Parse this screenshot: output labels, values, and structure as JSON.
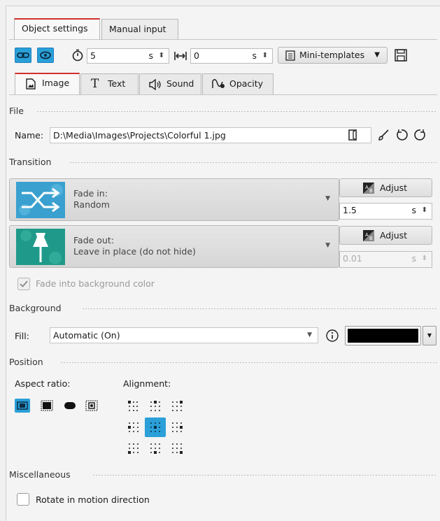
{
  "object_tabs": {
    "object_settings": "Object settings",
    "manual_input": "Manual input"
  },
  "toolbar": {
    "duration_value": "5",
    "duration_unit": "s",
    "offset_value": "0",
    "offset_unit": "s",
    "mini_templates": "Mini-templates"
  },
  "content_tabs": {
    "image": "Image",
    "text": "Text",
    "sound": "Sound",
    "opacity": "Opacity"
  },
  "file": {
    "section": "File",
    "name_label": "Name:",
    "name_value": "D:\\Media\\Images\\Projects\\Colorful 1.jpg"
  },
  "transition": {
    "section": "Transition",
    "fade_in_label": "Fade in:",
    "fade_in_value": "Random",
    "fade_out_label": "Fade out:",
    "fade_out_value": "Leave in place (do not hide)",
    "adjust_label": "Adjust",
    "fade_in_duration": "1.5",
    "fade_out_duration": "0.01",
    "unit": "s",
    "fade_bg_label": "Fade into background color",
    "fade_bg_checked": true
  },
  "background": {
    "section": "Background",
    "fill_label": "Fill:",
    "fill_value": "Automatic (On)",
    "color": "#000000"
  },
  "position": {
    "section": "Position",
    "aspect_label": "Aspect ratio:",
    "alignment_label": "Alignment:",
    "selected_alignment": "center"
  },
  "misc": {
    "section": "Miscellaneous",
    "rotate_label": "Rotate in motion direction",
    "rotate_checked": false
  },
  "colors": {
    "accent": "#2a9fd8",
    "tab_highlight": "#d32f2f"
  }
}
